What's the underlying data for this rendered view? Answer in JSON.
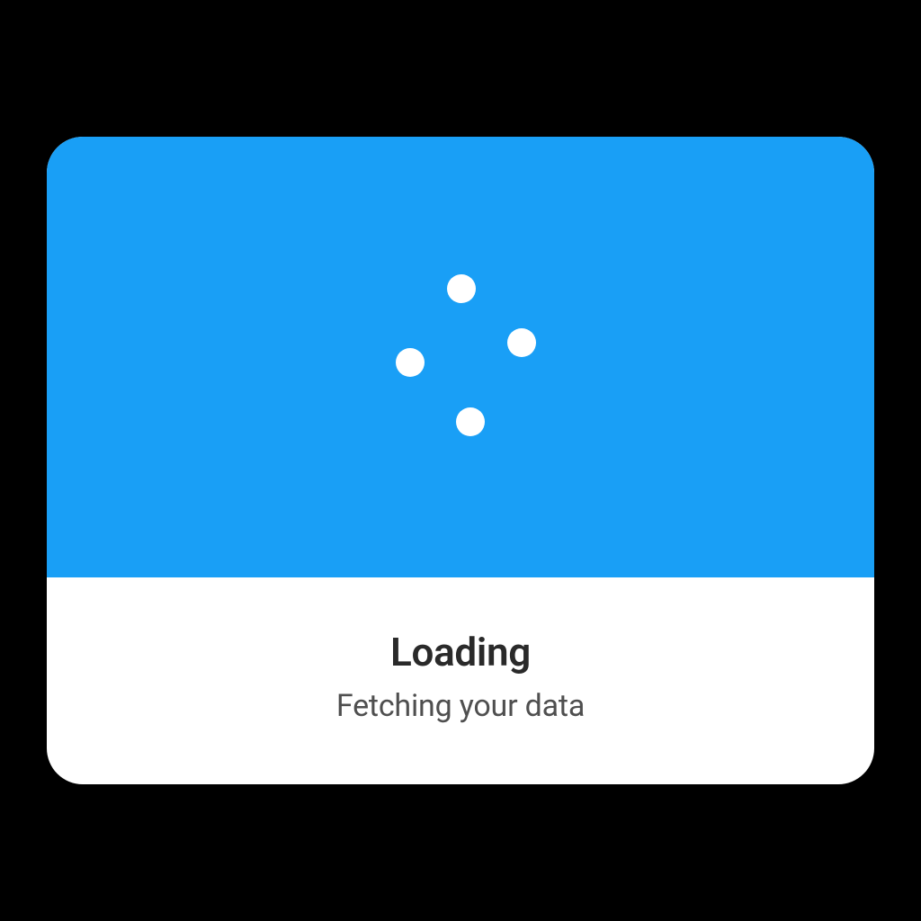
{
  "dialog": {
    "title": "Loading",
    "subtitle": "Fetching your data"
  },
  "colors": {
    "accent": "#199FF6",
    "background": "#000000",
    "card": "#ffffff"
  }
}
